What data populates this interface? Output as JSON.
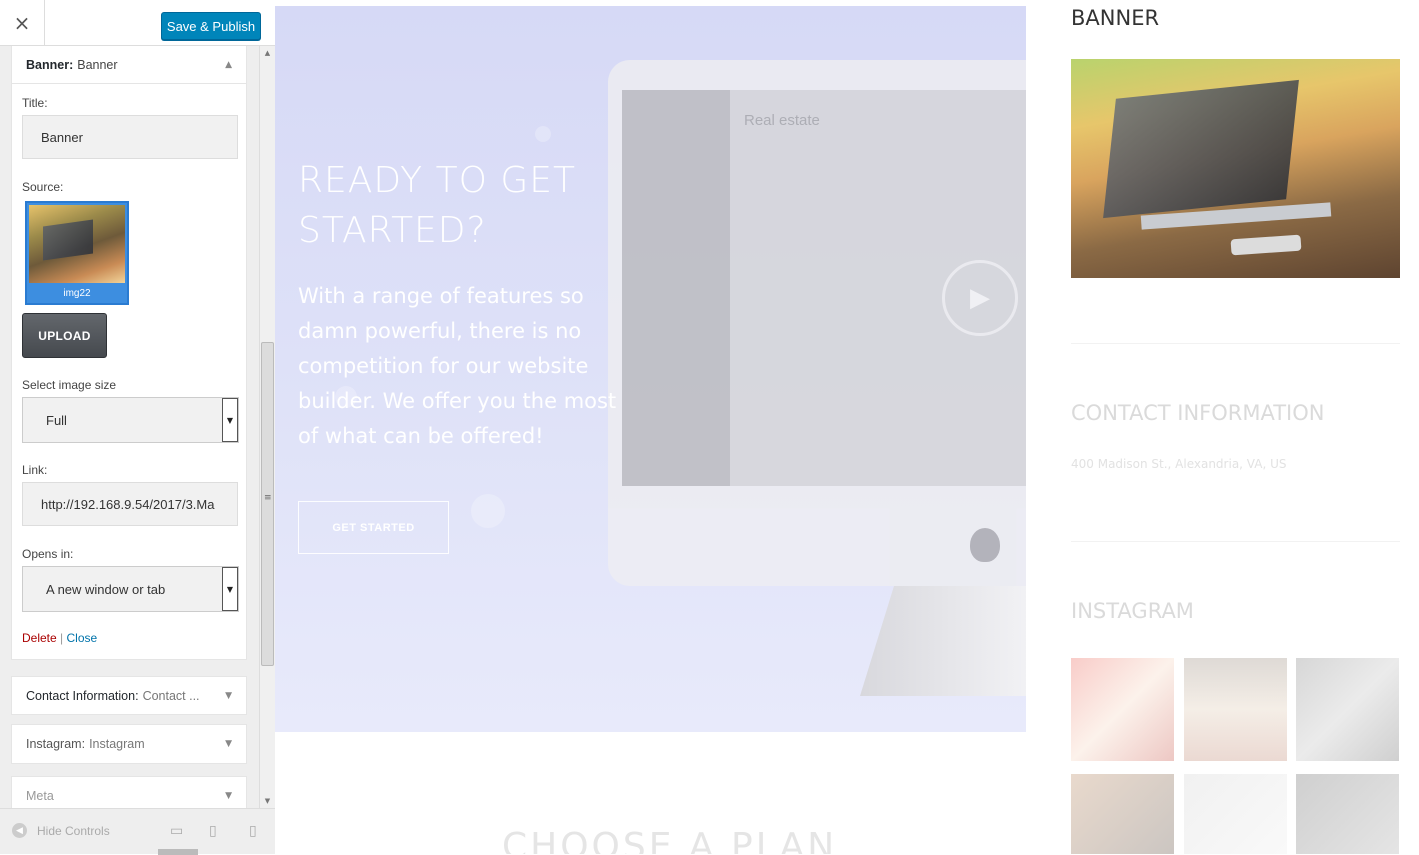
{
  "header": {
    "close_icon": "×",
    "publish_label": "Save & Publish"
  },
  "banner_section": {
    "title_bold": "Banner:",
    "title_name": "Banner",
    "title_label": "Title:",
    "title_value": "Banner",
    "source_label": "Source:",
    "image_name": "img22",
    "upload_label": "UPLOAD",
    "size_label": "Select image size",
    "size_value": "Full",
    "link_label": "Link:",
    "link_value": "http://192.168.9.54/2017/3.Ma",
    "opens_label": "Opens in:",
    "opens_value": "A new window or tab",
    "delete_label": "Delete",
    "separator": "|",
    "close_label": "Close"
  },
  "collapsed_sections": {
    "contact_bold": "Contact Information:",
    "contact_name": "Contact ...",
    "instagram_bold": "Instagram:",
    "instagram_name": "Instagram",
    "meta_name": "Meta"
  },
  "footer": {
    "hide_controls": "Hide Controls"
  },
  "hero": {
    "title": "READY TO GET STARTED?",
    "text": "With a range of features so damn powerful, there is no competition for our website builder. We offer you the most of what can be offered!",
    "button": "GET STARTED",
    "screen_title": "Real estate"
  },
  "widgets": {
    "banner_title": "BANNER",
    "contact_title": "CONTACT INFORMATION",
    "contact_address": "400 Madison St., Alexandria, VA, US",
    "instagram_title": "INSTAGRAM",
    "plan_title": "CHOOSE A PLAN"
  },
  "colors": {
    "primary_button": "#0085ba",
    "delete_link": "#aa0000",
    "close_link": "#0073aa",
    "hero_bg": "#d6d9f6"
  },
  "icons": {
    "collapse": "▲",
    "expand": "▼",
    "dropdown": "▼",
    "play": "▶"
  }
}
